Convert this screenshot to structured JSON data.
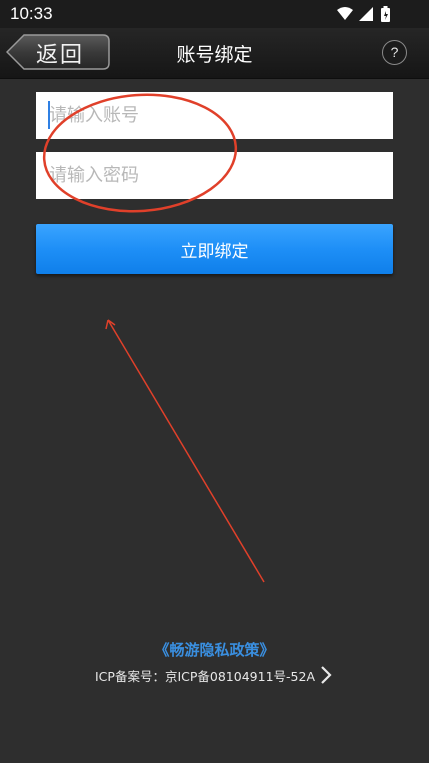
{
  "status_bar": {
    "time": "10:33",
    "icons": [
      "wifi-icon",
      "signal-icon",
      "battery-icon"
    ]
  },
  "header": {
    "back_label": "返回",
    "title": "账号绑定",
    "help_label": "?"
  },
  "form": {
    "account_placeholder": "请输入账号",
    "account_value": "",
    "password_placeholder": "请输入密码",
    "password_value": "",
    "submit_label": "立即绑定"
  },
  "footer": {
    "privacy_link": "《畅游隐私政策》",
    "icp_text": "ICP备案号：京ICP备08104911号-52A",
    "icp_arrow_icon": "chevron-right-icon"
  },
  "colors": {
    "background": "#2e2e2e",
    "accent_blue": "#1e8ff7",
    "link_blue": "#3a8fe0",
    "annotation_red": "#e0402a"
  }
}
